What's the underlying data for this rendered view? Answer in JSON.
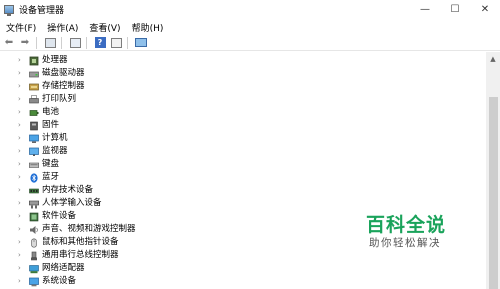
{
  "window": {
    "title": "设备管理器",
    "min_glyph": "—",
    "max_glyph": "☐",
    "close_glyph": "✕"
  },
  "menu": [
    "文件(F)",
    "操作(A)",
    "查看(V)",
    "帮助(H)"
  ],
  "toolbar": {
    "back_glyph": "⬅",
    "forward_glyph": "➡",
    "help_glyph": "?"
  },
  "tree": {
    "collapsed_glyph": "›",
    "items": [
      {
        "label": "处理器",
        "icon": "processor-icon"
      },
      {
        "label": "磁盘驱动器",
        "icon": "disk-drive-icon"
      },
      {
        "label": "存储控制器",
        "icon": "storage-controller-icon"
      },
      {
        "label": "打印队列",
        "icon": "print-queue-icon"
      },
      {
        "label": "电池",
        "icon": "battery-icon"
      },
      {
        "label": "固件",
        "icon": "firmware-icon"
      },
      {
        "label": "计算机",
        "icon": "computer-icon"
      },
      {
        "label": "监视器",
        "icon": "monitor-icon"
      },
      {
        "label": "键盘",
        "icon": "keyboard-icon"
      },
      {
        "label": "蓝牙",
        "icon": "bluetooth-icon"
      },
      {
        "label": "内存技术设备",
        "icon": "memory-device-icon"
      },
      {
        "label": "人体学输入设备",
        "icon": "hid-icon"
      },
      {
        "label": "软件设备",
        "icon": "software-device-icon"
      },
      {
        "label": "声音、视频和游戏控制器",
        "icon": "sound-icon"
      },
      {
        "label": "鼠标和其他指针设备",
        "icon": "mouse-icon"
      },
      {
        "label": "通用串行总线控制器",
        "icon": "usb-icon"
      },
      {
        "label": "网络适配器",
        "icon": "network-adapter-icon"
      },
      {
        "label": "系统设备",
        "icon": "system-device-icon"
      }
    ]
  },
  "scrollbar": {
    "up_glyph": "▲"
  },
  "watermark": {
    "title": "百科全说",
    "subtitle": "助你轻松解决"
  }
}
